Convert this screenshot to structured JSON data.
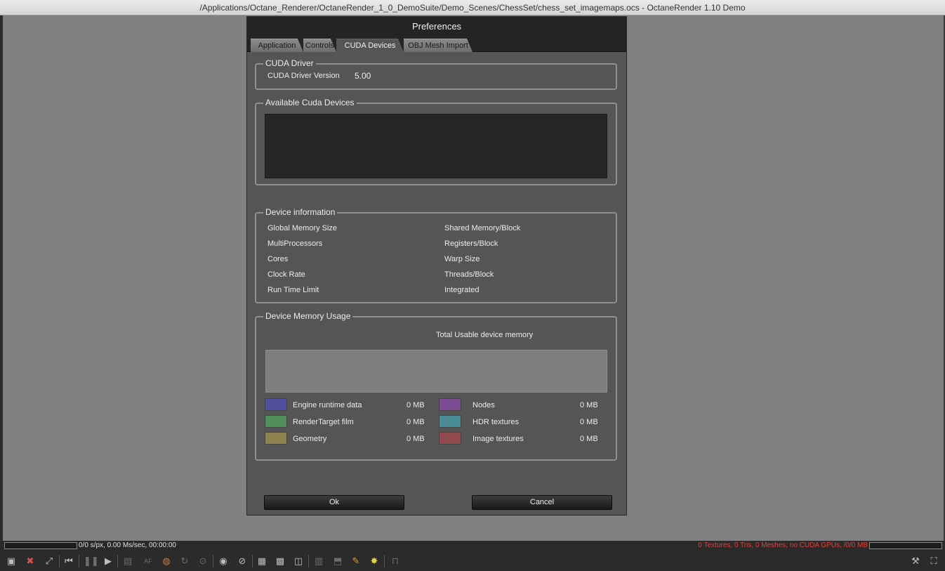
{
  "window": {
    "title": "/Applications/Octane_Renderer/OctaneRender_1_0_DemoSuite/Demo_Scenes/ChessSet/chess_set_imagemaps.ocs - OctaneRender 1.10 Demo"
  },
  "dialog": {
    "title": "Preferences",
    "tabs": [
      {
        "label": "Application"
      },
      {
        "label": "Controls"
      },
      {
        "label": "CUDA Devices"
      },
      {
        "label": "OBJ Mesh Import"
      }
    ],
    "active_tab": "CUDA Devices",
    "cuda_driver": {
      "group_label": "CUDA Driver",
      "version_label": "CUDA Driver Version",
      "version_value": "5.00"
    },
    "available_devices": {
      "group_label": "Available Cuda Devices"
    },
    "device_info": {
      "group_label": "Device information",
      "left": [
        "Global Memory Size",
        "MultiProcessors",
        "Cores",
        "Clock Rate",
        "Run Time Limit"
      ],
      "right": [
        "Shared Memory/Block",
        "Registers/Block",
        "Warp Size",
        "Threads/Block",
        "Integrated"
      ]
    },
    "memory_usage": {
      "group_label": "Device Memory Usage",
      "total_label": "Total Usable device memory",
      "legend": [
        {
          "label": "Engine runtime data",
          "value": "0 MB",
          "color": "#4e4f9a"
        },
        {
          "label": "Nodes",
          "value": "0 MB",
          "color": "#7e4a94"
        },
        {
          "label": "RenderTarget film",
          "value": "0 MB",
          "color": "#4f8f5c"
        },
        {
          "label": "HDR textures",
          "value": "0 MB",
          "color": "#4a8c94"
        },
        {
          "label": "Geometry",
          "value": "0 MB",
          "color": "#8f8450"
        },
        {
          "label": "Image textures",
          "value": "0 MB",
          "color": "#8f4a4e"
        }
      ]
    },
    "buttons": {
      "ok": "Ok",
      "cancel": "Cancel"
    }
  },
  "status": {
    "left": "0/0 s/px, 0.00 Ms/sec, 00:00:00",
    "right": "0 Textures, 0 Tris, 0 Meshes, no CUDA GPUs,  /0/0 MB"
  },
  "toolbar": {
    "af_label": "AF",
    "icons": [
      "screenshot-icon",
      "stop-render-icon",
      "fit-view-icon",
      "rewind-icon",
      "pause-icon",
      "play-icon",
      "display-icon",
      "af-icon",
      "color-wheel-icon",
      "refresh-icon",
      "focus-icon",
      "camera-icon",
      "lock-camera-icon",
      "grid-icon",
      "checker-icon",
      "region-icon",
      "film-icon",
      "save-icon",
      "palette-icon",
      "star-icon",
      "unlock-icon",
      "settings-icon",
      "fullscreen-icon"
    ]
  }
}
